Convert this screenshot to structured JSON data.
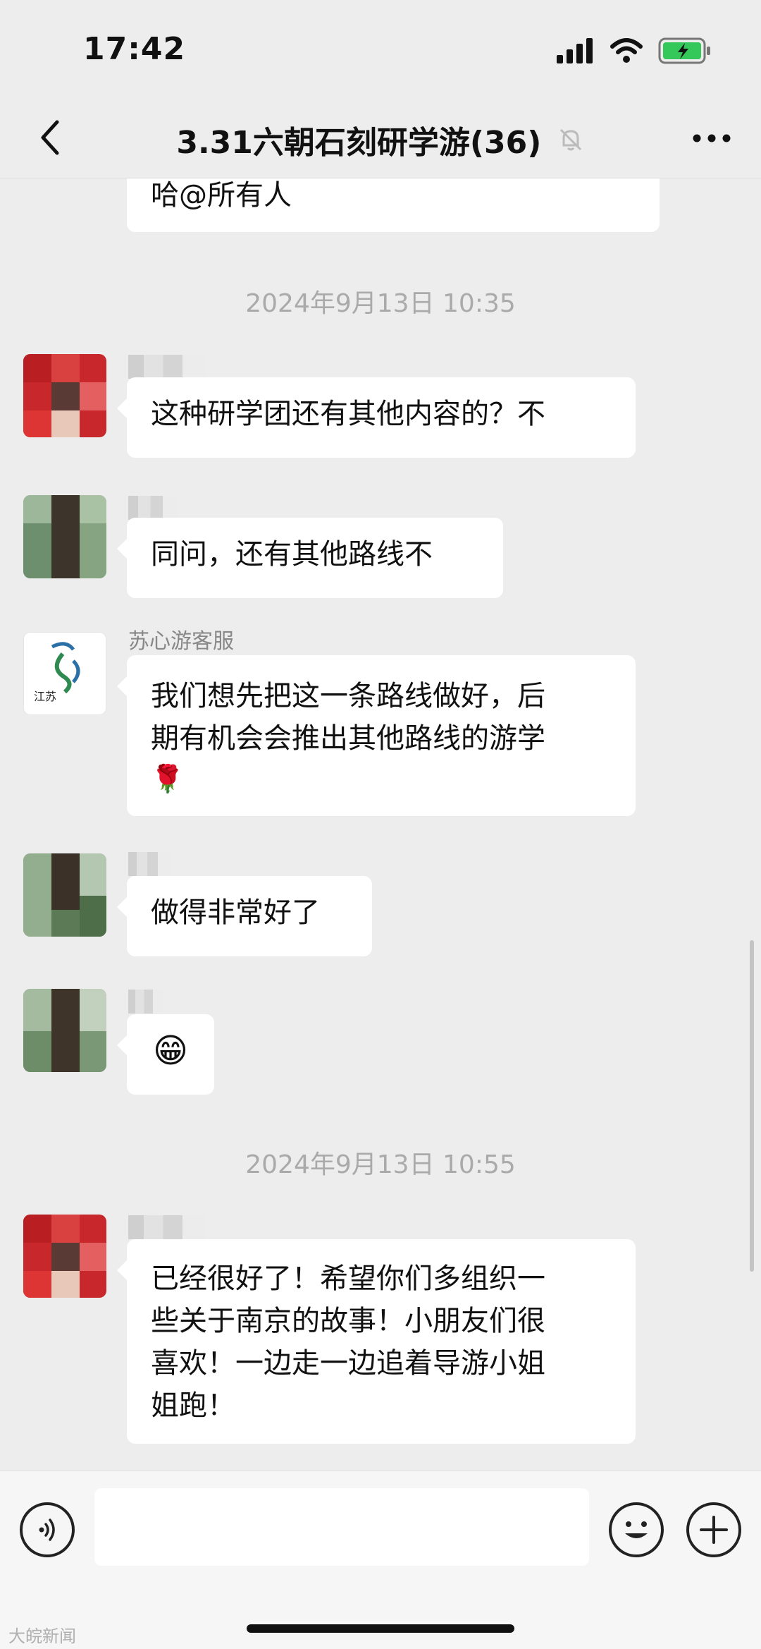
{
  "status_bar": {
    "time": "17:42"
  },
  "nav": {
    "title": "3.31六朝石刻研学游(36)"
  },
  "messages": {
    "partial_message": "哈@所有人",
    "timestamp_1": "2024年9月13日 10:35",
    "msg_1": "这种研学团还有其他内容的？不",
    "msg_2": "同问，还有其他路线不",
    "service_name": "苏心游客服",
    "msg_3_line_1": "我们想先把这一条路线做好，后",
    "msg_3_line_2": "期有机会会推出其他路线的游学",
    "msg_3_emoji": "🌹",
    "msg_4": "做得非常好了",
    "msg_5_emoji": "😁",
    "timestamp_2": "2024年9月13日 10:55",
    "msg_6_line_1": "已经很好了！希望你们多组织一",
    "msg_6_line_2": "些关于南京的故事！小朋友们很",
    "msg_6_line_3": "喜欢！一边走一边追着导游小姐",
    "msg_6_line_4": "姐跑！"
  },
  "service_logo": {
    "text": "江苏"
  },
  "input_bar": {
    "placeholder": ""
  },
  "watermark": "大皖新闻",
  "colors": {
    "background": "#ededed",
    "bubble": "#ffffff",
    "battery": "#34c759",
    "timestamp": "#aaaaaa"
  },
  "icons": [
    "signal-icon",
    "wifi-icon",
    "battery-charging-icon",
    "back-chevron-icon",
    "mute-bell-icon",
    "more-dots-icon",
    "voice-icon",
    "emoji-icon",
    "plus-icon"
  ]
}
